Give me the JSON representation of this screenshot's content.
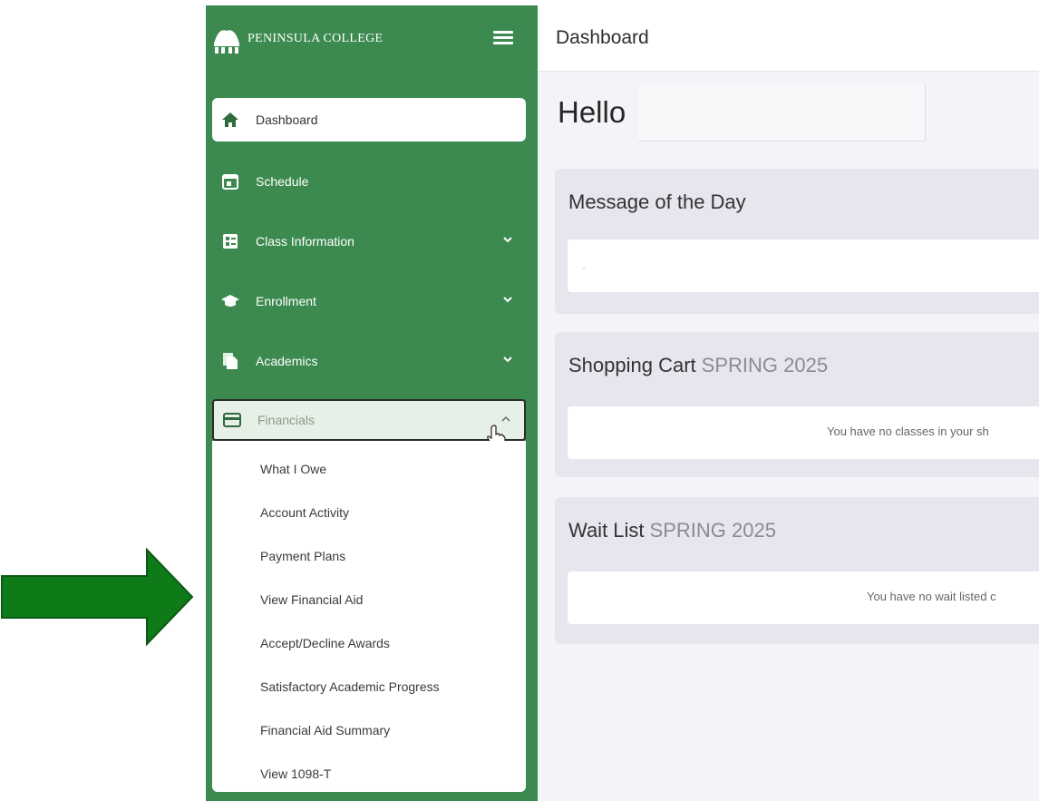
{
  "brand": {
    "name": "PENINSULA COLLEGE"
  },
  "colors": {
    "sidebar": "#3c8a4f",
    "arrow": "#0f7a18",
    "content_bg": "#f4f3f8",
    "card_bg": "#e7e6ef"
  },
  "nav": {
    "dashboard": "Dashboard",
    "schedule": "Schedule",
    "class_information": "Class Information",
    "enrollment": "Enrollment",
    "academics": "Academics",
    "financials": "Financials"
  },
  "icons": {
    "menu": "hamburger-icon",
    "dashboard": "home-icon",
    "schedule": "calendar-icon",
    "class_information": "class-info-icon",
    "enrollment": "graduation-cap-icon",
    "academics": "documents-icon",
    "financials": "credit-card-icon",
    "expand": "chevron-down-icon",
    "collapse": "chevron-up-icon",
    "cursor": "hand-pointer-icon",
    "annotation": "right-arrow-icon"
  },
  "financials_menu": [
    "What I Owe",
    "Account Activity",
    "Payment Plans",
    "View Financial Aid",
    "Accept/Decline Awards",
    "Satisfactory Academic Progress",
    "Financial Aid Summary",
    "View 1098-T"
  ],
  "header": {
    "title": "Dashboard"
  },
  "main": {
    "greeting": "Hello",
    "message_of_day": {
      "title": "Message of the Day",
      "body": "-"
    },
    "shopping_cart": {
      "title": "Shopping Cart",
      "term": "SPRING 2025",
      "empty": "You have no classes in your sh"
    },
    "wait_list": {
      "title": "Wait List",
      "term": "SPRING 2025",
      "empty": "You have no wait listed c"
    }
  }
}
